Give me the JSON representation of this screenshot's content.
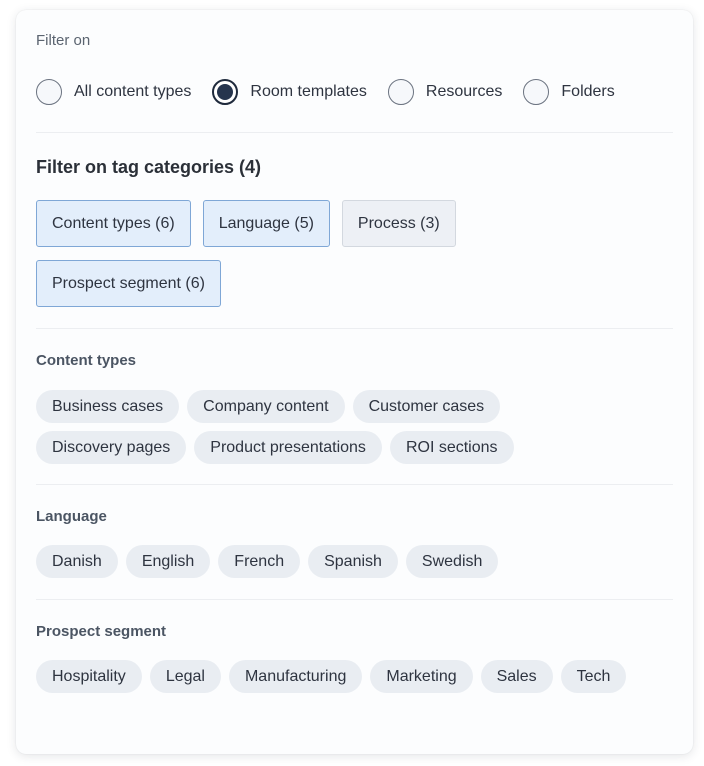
{
  "filter_on": {
    "label": "Filter on",
    "options": [
      {
        "label": "All content types",
        "checked": false
      },
      {
        "label": "Room templates",
        "checked": true
      },
      {
        "label": "Resources",
        "checked": false
      },
      {
        "label": "Folders",
        "checked": false
      }
    ]
  },
  "tag_categories": {
    "title": "Filter on tag categories (4)",
    "buttons": [
      {
        "label": "Content types (6)",
        "selected": true
      },
      {
        "label": "Language (5)",
        "selected": true
      },
      {
        "label": "Process (3)",
        "selected": false
      },
      {
        "label": "Prospect segment (6)",
        "selected": true
      }
    ]
  },
  "groups": [
    {
      "title": "Content types",
      "tags": [
        "Business cases",
        "Company content",
        "Customer cases",
        "Discovery pages",
        "Product presentations",
        "ROI sections"
      ]
    },
    {
      "title": "Language",
      "tags": [
        "Danish",
        "English",
        "French",
        "Spanish",
        "Swedish"
      ]
    },
    {
      "title": "Prospect segment",
      "tags": [
        "Hospitality",
        "Legal",
        "Manufacturing",
        "Marketing",
        "Sales",
        "Tech"
      ]
    }
  ],
  "colors": {
    "selected_category_bg": "#e3eefb",
    "selected_category_border": "#7fa7d6",
    "radio_checked": "#25344d",
    "chip_bg": "#e9edf2"
  }
}
